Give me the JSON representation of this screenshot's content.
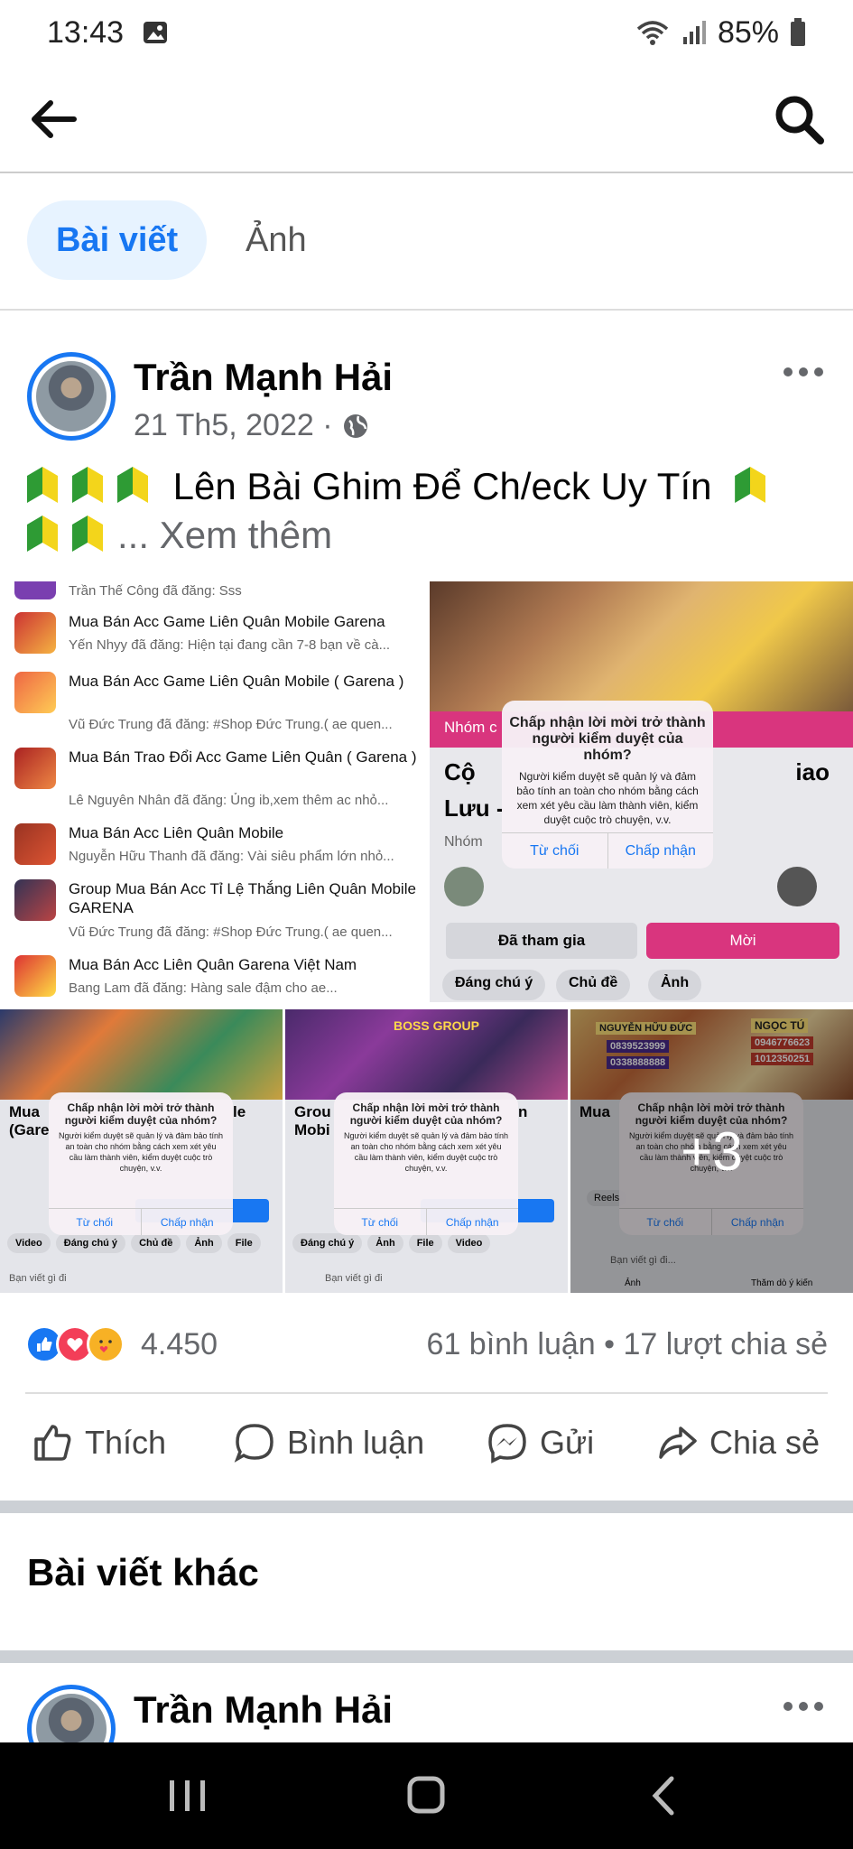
{
  "status": {
    "time": "13:43",
    "battery": "85%"
  },
  "tabs": [
    {
      "label": "Bài viết"
    },
    {
      "label": "Ảnh"
    }
  ],
  "post": {
    "author": "Trần Mạnh Hải",
    "date": "21 Th5, 2022 ·",
    "text": "Lên Bài Ghim Để Ch/eck Uy Tín",
    "see_more": "... Xem thêm"
  },
  "group_list": [
    {
      "title": "",
      "sub": "Trần Thế Công đã đăng: Sss"
    },
    {
      "title": "Mua Bán Acc Game Liên Quân Mobile Garena",
      "sub": "Yến Nhyy đã đăng: Hiện tại đang cần 7-8 bạn về cà..."
    },
    {
      "title": "Mua Bán Acc Game Liên Quân Mobile ( Garena )",
      "sub": "Vũ Đức Trung đã đăng: #Shop Đức Trung.( ae quen..."
    },
    {
      "title": "Mua Bán Trao Đổi Acc Game Liên Quân ( Garena )",
      "sub": "Lê Nguyên Nhân đã đăng: Ủng ib,xem thêm ac nhỏ..."
    },
    {
      "title": "Mua Bán Acc Liên Quân Mobile",
      "sub": "Nguyễn Hữu Thanh đã đăng: Vài siêu phẩm lớn nhỏ..."
    },
    {
      "title": "Group Mua Bán Acc Tỉ Lệ Thắng Liên Quân Mobile GARENA",
      "sub": "Vũ Đức Trung đã đăng: #Shop Đức Trung.( ae quen..."
    },
    {
      "title": "Mua Bán Acc Liên Quân Garena Việt Nam",
      "sub": "Bang Lam đã đăng: Hàng sale đậm cho ae..."
    }
  ],
  "card": {
    "banner_label": "Nhóm c",
    "title_left": "Cộ",
    "title_right": "iao",
    "title_line2": "Lưu -",
    "privacy": "Nhóm",
    "joined": "Đã tham gia",
    "invite": "Mời",
    "chips": [
      "Đáng chú ý",
      "Chủ đề",
      "Ảnh"
    ]
  },
  "dialog": {
    "title": "Chấp nhận lời mời trở thành người kiểm duyệt của nhóm?",
    "body": "Người kiểm duyệt sẽ quản lý và đảm bảo tính an toàn cho nhóm bằng cách xem xét yêu cầu làm thành viên, kiểm duyệt cuộc trò chuyện, v.v.",
    "reject": "Từ chối",
    "accept": "Chấp nhận"
  },
  "thumbs": {
    "t1": {
      "left": "Mua",
      "left2": "(Gare",
      "right": "le",
      "chips": [
        "Video",
        "Đáng chú ý",
        "Chủ đề",
        "Ảnh",
        "File"
      ],
      "composer": "Bạn viết gì đi"
    },
    "t2": {
      "banner": "BOSS GROUP",
      "left": "Grou",
      "left2": "Mobi",
      "right": "n",
      "chips": [
        "Đáng chú ý",
        "Ảnh",
        "File",
        "Video"
      ],
      "composer": "Bạn viết gì đi"
    },
    "t3": {
      "left": "Mua",
      "reels": "Reels",
      "composer": "Bạn viết gì đi...",
      "photo": "Ảnh",
      "poll": "Thăm dò ý kiến",
      "plus": "+3",
      "shop_left": "NGUYỄN HỮU ĐỨC",
      "phone1": "0839523999",
      "phone2": "0338888888",
      "shop_right": "NGỌC TÚ",
      "phone3": "0946776623",
      "phone4": "1012350251"
    }
  },
  "stats": {
    "reactions": "4.450",
    "comments_shares": "61 bình luận • 17 lượt chia sẻ"
  },
  "actions": {
    "like": "Thích",
    "comment": "Bình luận",
    "send": "Gửi",
    "share": "Chia sẻ"
  },
  "other_posts": {
    "heading": "Bài viết khác",
    "author": "Trần Mạnh Hải"
  },
  "colors": {
    "accent": "#1877f2",
    "pink": "#d9357e"
  }
}
